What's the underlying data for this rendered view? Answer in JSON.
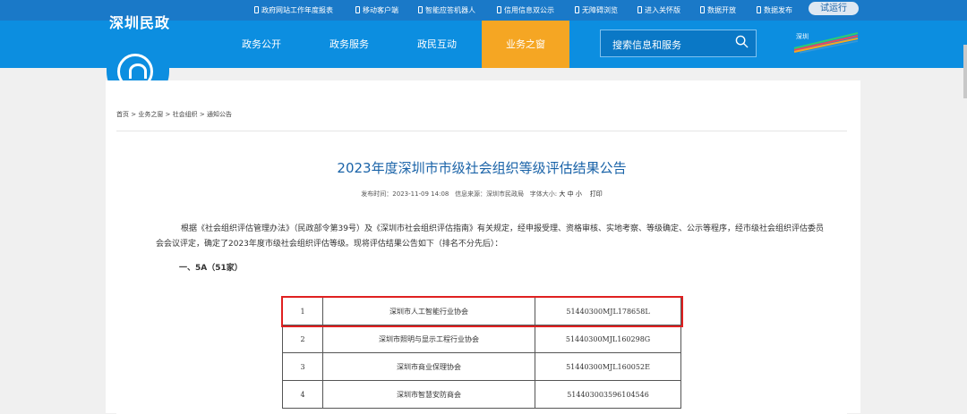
{
  "topbar": {
    "links": [
      {
        "label": "政府网站工作年度报表",
        "icon": "phone-icon"
      },
      {
        "label": "移动客户端",
        "icon": "phone-icon"
      },
      {
        "label": "智能应答机器人",
        "icon": "phone-icon"
      },
      {
        "label": "信用信息双公示",
        "icon": "phone-icon"
      },
      {
        "label": "无障碍浏览",
        "icon": "phone-icon"
      },
      {
        "label": "进入关怀版",
        "icon": "phone-icon"
      },
      {
        "label": "数据开放",
        "icon": "phone-icon"
      },
      {
        "label": "数据发布",
        "icon": "phone-icon"
      }
    ],
    "trial": "试运行"
  },
  "header": {
    "logo": "深圳民政",
    "nav": [
      "政务公开",
      "政务服务",
      "政民互动",
      "业务之窗"
    ],
    "active_nav": "业务之窗",
    "search_placeholder": "搜索信息和服务"
  },
  "breadcrumb": "首页 > 业务之窗 > 社会组织 > 通知公告",
  "article": {
    "title": "2023年度深圳市市级社会组织等级评估结果公告",
    "meta": {
      "time_label": "发布时间：",
      "time": "2023-11-09 14:08",
      "source_label": "信息来源：",
      "source": "深圳市民政局",
      "fontsize_label": "字体大小:",
      "sizes": [
        "大",
        "中",
        "小"
      ],
      "print": "打印"
    },
    "paragraph": "根据《社会组织评估管理办法》（民政部令第39号）及《深圳市社会组织评估指南》有关规定，经申报受理、资格审核、实地考察、等级确定、公示等程序，经市级社会组织评估委员会会议评定，确定了2023年度市级社会组织评估等级。现将评估结果公告如下（排名不分先后）：",
    "section": "一、5A（51家）",
    "rows": [
      {
        "no": "1",
        "name": "深圳市人工智能行业协会",
        "code": "51440300MJL178658L"
      },
      {
        "no": "2",
        "name": "深圳市照明与显示工程行业协会",
        "code": "51440300MJL160298G"
      },
      {
        "no": "3",
        "name": "深圳市商业保理协会",
        "code": "51440300MJL160052E"
      },
      {
        "no": "4",
        "name": "深圳市智慧安防商会",
        "code": "514403003596104546"
      }
    ]
  },
  "colors": {
    "primary": "#0c8ee0",
    "accent": "#f5a623",
    "highlight": "#e02020",
    "title": "#1a63a8"
  }
}
